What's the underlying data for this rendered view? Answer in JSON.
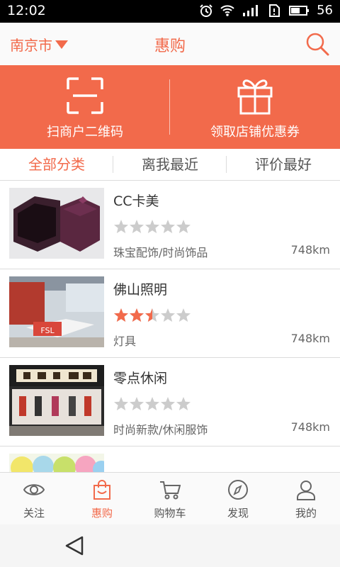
{
  "status_bar": {
    "time": "12:02",
    "battery": "56"
  },
  "header": {
    "city": "南京市",
    "title": "惠购"
  },
  "banner": {
    "scan_label": "扫商户二维码",
    "coupon_label": "领取店铺优惠券"
  },
  "tabs": [
    {
      "label": "全部分类",
      "active": true
    },
    {
      "label": "离我最近",
      "active": false
    },
    {
      "label": "评价最好",
      "active": false
    }
  ],
  "shops": [
    {
      "name": "CC卡美",
      "rating": 0,
      "category": "珠宝配饰/时尚饰品",
      "distance": "748km"
    },
    {
      "name": "佛山照明",
      "rating": 2.5,
      "category": "灯具",
      "distance": "748km",
      "thumb_text": "FSL"
    },
    {
      "name": "零点休闲",
      "rating": 0,
      "category": "时尚新款/休闲服饰",
      "distance": "748km"
    }
  ],
  "nav": [
    {
      "label": "关注",
      "icon": "eye-icon",
      "active": false
    },
    {
      "label": "惠购",
      "icon": "shopping-bag-icon",
      "active": true
    },
    {
      "label": "购物车",
      "icon": "cart-icon",
      "active": false
    },
    {
      "label": "发现",
      "icon": "compass-icon",
      "active": false
    },
    {
      "label": "我的",
      "icon": "user-icon",
      "active": false
    }
  ],
  "colors": {
    "accent": "#f26a4b",
    "star_on": "#f26a4b",
    "star_off": "#cccccc"
  }
}
